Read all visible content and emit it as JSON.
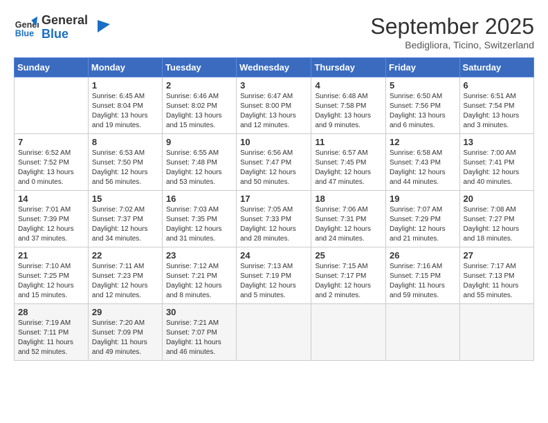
{
  "logo": {
    "line1": "General",
    "line2": "Blue"
  },
  "title": "September 2025",
  "location": "Bedigliora, Ticino, Switzerland",
  "weekdays": [
    "Sunday",
    "Monday",
    "Tuesday",
    "Wednesday",
    "Thursday",
    "Friday",
    "Saturday"
  ],
  "weeks": [
    [
      {
        "day": "",
        "info": ""
      },
      {
        "day": "1",
        "info": "Sunrise: 6:45 AM\nSunset: 8:04 PM\nDaylight: 13 hours\nand 19 minutes."
      },
      {
        "day": "2",
        "info": "Sunrise: 6:46 AM\nSunset: 8:02 PM\nDaylight: 13 hours\nand 15 minutes."
      },
      {
        "day": "3",
        "info": "Sunrise: 6:47 AM\nSunset: 8:00 PM\nDaylight: 13 hours\nand 12 minutes."
      },
      {
        "day": "4",
        "info": "Sunrise: 6:48 AM\nSunset: 7:58 PM\nDaylight: 13 hours\nand 9 minutes."
      },
      {
        "day": "5",
        "info": "Sunrise: 6:50 AM\nSunset: 7:56 PM\nDaylight: 13 hours\nand 6 minutes."
      },
      {
        "day": "6",
        "info": "Sunrise: 6:51 AM\nSunset: 7:54 PM\nDaylight: 13 hours\nand 3 minutes."
      }
    ],
    [
      {
        "day": "7",
        "info": "Sunrise: 6:52 AM\nSunset: 7:52 PM\nDaylight: 13 hours\nand 0 minutes."
      },
      {
        "day": "8",
        "info": "Sunrise: 6:53 AM\nSunset: 7:50 PM\nDaylight: 12 hours\nand 56 minutes."
      },
      {
        "day": "9",
        "info": "Sunrise: 6:55 AM\nSunset: 7:48 PM\nDaylight: 12 hours\nand 53 minutes."
      },
      {
        "day": "10",
        "info": "Sunrise: 6:56 AM\nSunset: 7:47 PM\nDaylight: 12 hours\nand 50 minutes."
      },
      {
        "day": "11",
        "info": "Sunrise: 6:57 AM\nSunset: 7:45 PM\nDaylight: 12 hours\nand 47 minutes."
      },
      {
        "day": "12",
        "info": "Sunrise: 6:58 AM\nSunset: 7:43 PM\nDaylight: 12 hours\nand 44 minutes."
      },
      {
        "day": "13",
        "info": "Sunrise: 7:00 AM\nSunset: 7:41 PM\nDaylight: 12 hours\nand 40 minutes."
      }
    ],
    [
      {
        "day": "14",
        "info": "Sunrise: 7:01 AM\nSunset: 7:39 PM\nDaylight: 12 hours\nand 37 minutes."
      },
      {
        "day": "15",
        "info": "Sunrise: 7:02 AM\nSunset: 7:37 PM\nDaylight: 12 hours\nand 34 minutes."
      },
      {
        "day": "16",
        "info": "Sunrise: 7:03 AM\nSunset: 7:35 PM\nDaylight: 12 hours\nand 31 minutes."
      },
      {
        "day": "17",
        "info": "Sunrise: 7:05 AM\nSunset: 7:33 PM\nDaylight: 12 hours\nand 28 minutes."
      },
      {
        "day": "18",
        "info": "Sunrise: 7:06 AM\nSunset: 7:31 PM\nDaylight: 12 hours\nand 24 minutes."
      },
      {
        "day": "19",
        "info": "Sunrise: 7:07 AM\nSunset: 7:29 PM\nDaylight: 12 hours\nand 21 minutes."
      },
      {
        "day": "20",
        "info": "Sunrise: 7:08 AM\nSunset: 7:27 PM\nDaylight: 12 hours\nand 18 minutes."
      }
    ],
    [
      {
        "day": "21",
        "info": "Sunrise: 7:10 AM\nSunset: 7:25 PM\nDaylight: 12 hours\nand 15 minutes."
      },
      {
        "day": "22",
        "info": "Sunrise: 7:11 AM\nSunset: 7:23 PM\nDaylight: 12 hours\nand 12 minutes."
      },
      {
        "day": "23",
        "info": "Sunrise: 7:12 AM\nSunset: 7:21 PM\nDaylight: 12 hours\nand 8 minutes."
      },
      {
        "day": "24",
        "info": "Sunrise: 7:13 AM\nSunset: 7:19 PM\nDaylight: 12 hours\nand 5 minutes."
      },
      {
        "day": "25",
        "info": "Sunrise: 7:15 AM\nSunset: 7:17 PM\nDaylight: 12 hours\nand 2 minutes."
      },
      {
        "day": "26",
        "info": "Sunrise: 7:16 AM\nSunset: 7:15 PM\nDaylight: 11 hours\nand 59 minutes."
      },
      {
        "day": "27",
        "info": "Sunrise: 7:17 AM\nSunset: 7:13 PM\nDaylight: 11 hours\nand 55 minutes."
      }
    ],
    [
      {
        "day": "28",
        "info": "Sunrise: 7:19 AM\nSunset: 7:11 PM\nDaylight: 11 hours\nand 52 minutes."
      },
      {
        "day": "29",
        "info": "Sunrise: 7:20 AM\nSunset: 7:09 PM\nDaylight: 11 hours\nand 49 minutes."
      },
      {
        "day": "30",
        "info": "Sunrise: 7:21 AM\nSunset: 7:07 PM\nDaylight: 11 hours\nand 46 minutes."
      },
      {
        "day": "",
        "info": ""
      },
      {
        "day": "",
        "info": ""
      },
      {
        "day": "",
        "info": ""
      },
      {
        "day": "",
        "info": ""
      }
    ]
  ]
}
